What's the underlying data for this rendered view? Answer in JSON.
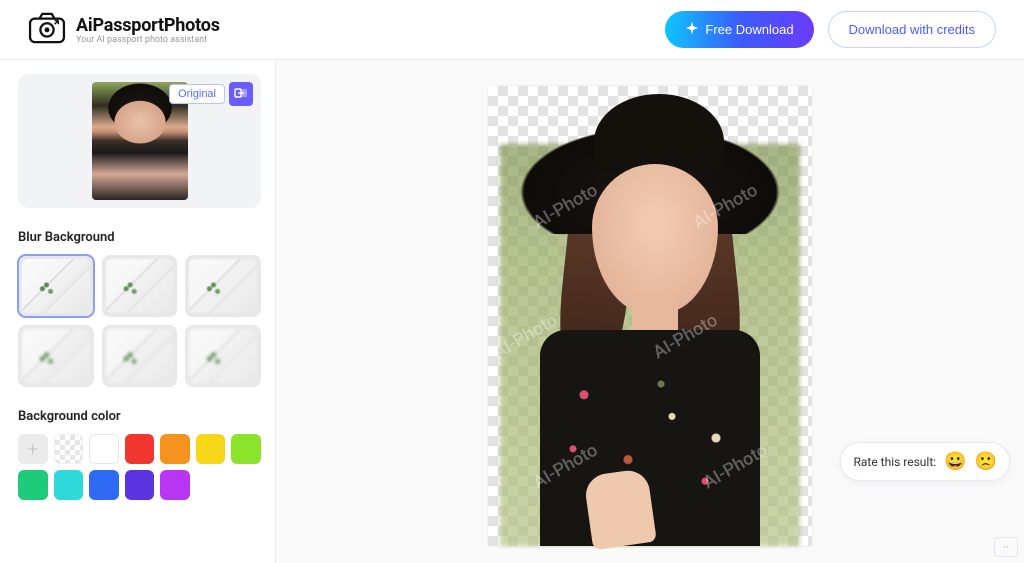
{
  "header": {
    "brand_title": "AiPassportPhotos",
    "brand_subtitle": "Your AI passport photo assistant",
    "free_download_label": "Free Download",
    "download_credits_label": "Download with credits"
  },
  "thumb": {
    "original_label": "Original"
  },
  "sections": {
    "blur_title": "Blur Background",
    "bgcolor_title": "Background color"
  },
  "bg_colors": [
    "add",
    "transparent",
    "white",
    "#f0362f",
    "#f6921e",
    "#f7d717",
    "#8ce32b",
    "#1ecb7a",
    "#2dd9d9",
    "#2f6af5",
    "#5b33e0",
    "#b836f2"
  ],
  "rate": {
    "label": "Rate this result:"
  },
  "preview": {
    "watermark_text": "AI-Photo"
  }
}
